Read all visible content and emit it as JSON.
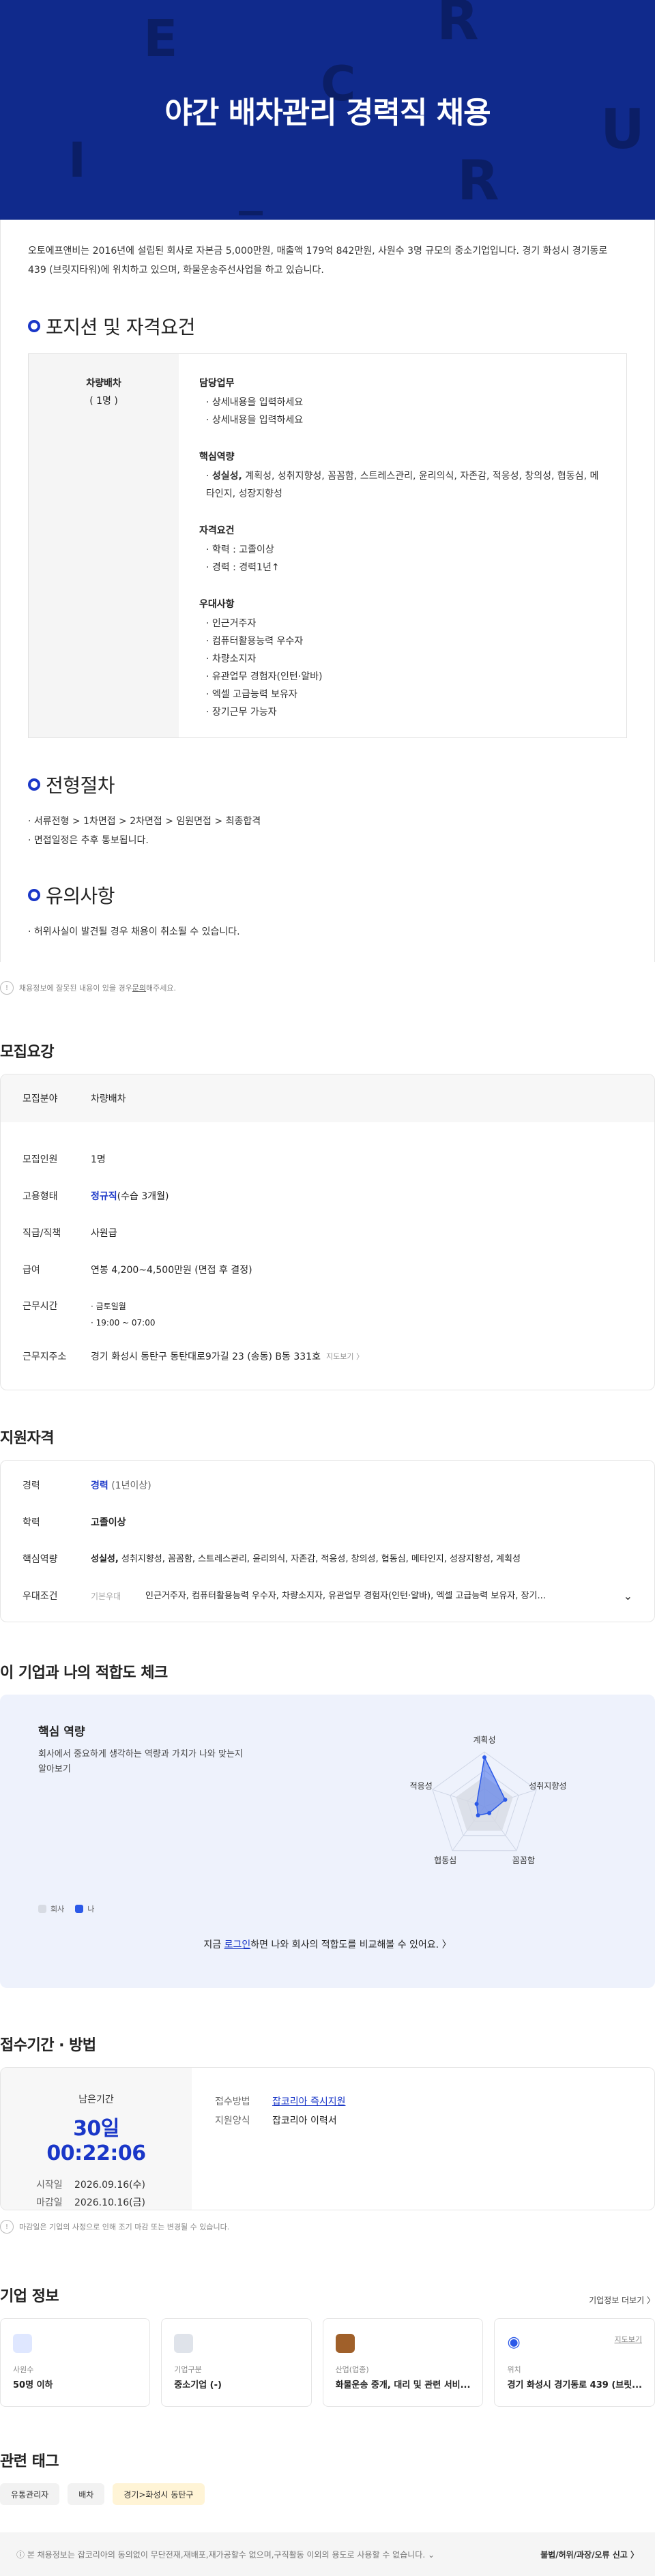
{
  "hero": {
    "title": "야간 배차관리 경력직 채용"
  },
  "intro": "오토에프앤비는 2016년에 설립된 회사로 자본금 5,000만원, 매출액 179억 842만원, 사원수 3명 규모의 중소기업입니다. 경기 화성시 경기동로 439 (브릿지타워)에 위치하고 있으며, 화물운송주선사업을 하고 있습니다.",
  "position": {
    "heading": "포지션 및 자격요건",
    "role": "차량배차",
    "count": "( 1명 )",
    "duties_title": "담당업무",
    "duties": [
      "상세내용을 입력하세요",
      "상세내용을 입력하세요"
    ],
    "competency_title": "핵심역량",
    "competency_bold": "성실성,",
    "competency_rest": " 계획성, 성취지향성, 꼼꼼함, 스트레스관리, 윤리의식, 자존감, 적응성, 창의성, 협동심, 메타인지, 성장지향성",
    "qual_title": "자격요건",
    "quals": [
      "학력 : 고졸이상",
      "경력 : 경력1년↑"
    ],
    "pref_title": "우대사항",
    "prefs": [
      "인근거주자",
      "컴퓨터활용능력 우수자",
      "차량소지자",
      "유관업무 경험자(인턴·알바)",
      "엑셀 고급능력 보유자",
      "장기근무 가능자"
    ]
  },
  "process": {
    "heading": "전형절차",
    "steps": "서류전형 > 1차면접 > 2차면접 > 임원면접 > 최종합격",
    "note": "면접일정은 추후 통보됩니다."
  },
  "caution": {
    "heading": "유의사항",
    "text": "허위사실이 발견될 경우 채용이 취소될 수 있습니다."
  },
  "disclaimer": {
    "icon": "!",
    "before": "채용정보에 잘못된 내용이 있을 경우 ",
    "link": "문의",
    "after": "해주세요."
  },
  "recruit": {
    "title": "모집요강",
    "field_label": "모집분야",
    "field_value": "차량배차",
    "rows": [
      {
        "k": "모집인원",
        "v": "1명"
      },
      {
        "k": "고용형태",
        "v_blue": "정규직",
        "v": "(수습 3개월)"
      },
      {
        "k": "직급/직책",
        "v": "사원급"
      },
      {
        "k": "급여",
        "v": "연봉 4,200~4,500만원 (면접 후 결정)"
      }
    ],
    "work_time_label": "근무시간",
    "work_days": "금토일월",
    "work_hours": "19:00 ~ 07:00",
    "address_label": "근무지주소",
    "address": "경기 화성시 동탄구 동탄대로9가길 23 (송동) B동 331호",
    "map_link": "지도보기 〉"
  },
  "qual": {
    "title": "지원자격",
    "career_label": "경력",
    "career_blue": "경력",
    "career_rest": " (1년이상)",
    "edu_label": "학력",
    "edu_blue": "고졸이상",
    "core_label": "핵심역량",
    "core_bold": "성실성,",
    "core_rest": " 성취지향성, 꼼꼼함, 스트레스관리, 윤리의식, 자존감, 적응성, 창의성, 협동심, 메타인지, 성장지향성, 계획성",
    "pref_label": "우대조건",
    "pref_sub": "기본우대",
    "pref_text": "인근거주자, 컴퓨터활용능력 우수자, 차량소지자, 유관업무 경험자(인턴·알바), 엑셀 고급능력 보유자, 장기..."
  },
  "fit": {
    "title": "이 기업과 나의 적합도 체크",
    "card_title": "핵심 역량",
    "desc": "회사에서 중요하게 생각하는 역량과 가치가 나와 맞는지 알아보기",
    "legend_company": "회사",
    "legend_me": "나",
    "axes": [
      "계획성",
      "성취지향성",
      "꼼꼼함",
      "협동심",
      "적응성"
    ],
    "company": [
      0.55,
      0.55,
      0.55,
      0.55,
      0.55
    ],
    "me": [
      0.9,
      0.4,
      0.15,
      0.2,
      0.15
    ],
    "cta_before": "지금 ",
    "cta_link": "로그인",
    "cta_after": "하면 나와 회사의 적합도를 비교해볼 수 있어요. 〉",
    "colors": {
      "company": "#d7dbe3",
      "me": "#2b59e8"
    }
  },
  "apply": {
    "title": "접수기간 · 방법",
    "remain_label": "남은기간",
    "countdown": "30일 00:22:06",
    "start_label": "시작일",
    "start": "2026.09.16(수)",
    "end_label": "마감일",
    "end": "2026.10.16(금)",
    "method_label": "접수방법",
    "method": "잡코리아 즉시지원",
    "form_label": "지원양식",
    "form": "잡코리아 이력서",
    "note": "마감일은 기업의 사정으로 인해 조기 마감 또는 변경될 수 있습니다."
  },
  "company": {
    "title": "기업 정보",
    "more": "기업정보 더보기 〉",
    "cards": [
      {
        "icon": "people-icon",
        "k": "사원수",
        "v": "50명 이하"
      },
      {
        "icon": "building-icon",
        "k": "기업구분",
        "v": "중소기업 (-)"
      },
      {
        "icon": "briefcase-icon",
        "k": "산업(업종)",
        "v": "화물운송 중개, 대리 및 관련 서비..."
      },
      {
        "icon": "location-icon",
        "k": "위치",
        "v": "경기 화성시 경기동로 439 (브릿..."
      }
    ],
    "map_link": "지도보기"
  },
  "tags": {
    "title": "관련 태그",
    "items": [
      "유통관리자",
      "배차",
      "경기>화성시 동탄구"
    ]
  },
  "footer": {
    "text": "본 채용정보는 잡코리아의 동의없이 무단전재,재배포,재가공할수 없으며,구직활동 이외의 용도로 사용할 수 없습니다.",
    "report": "불법/허위/과장/오류 신고 〉"
  }
}
